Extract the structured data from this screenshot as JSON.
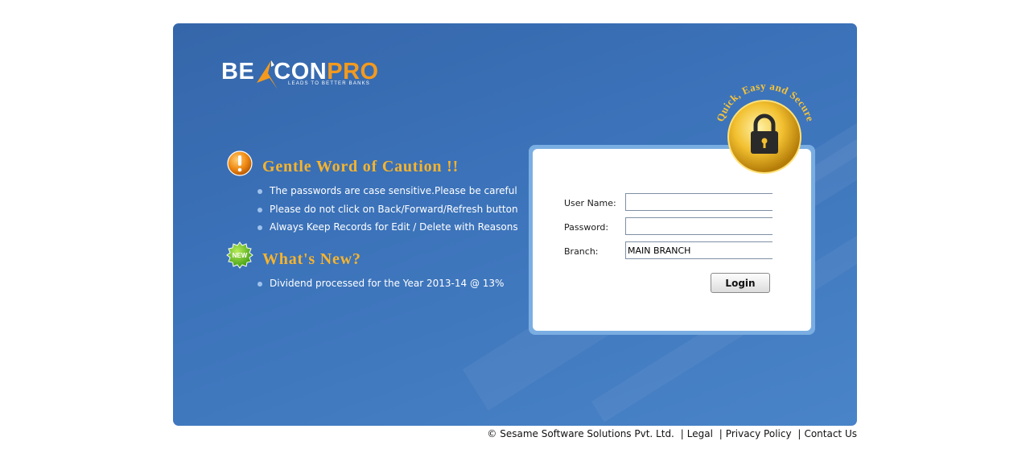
{
  "logo": {
    "part1": "BE",
    "part2": "CON",
    "part3": "PRO",
    "tagline": "LEADS TO BETTER BANKS",
    "brand_orange": "#f39a1e"
  },
  "seal": {
    "text": "Quick, Easy and Secure",
    "icon": "padlock-icon"
  },
  "caution": {
    "icon": "exclamation-icon",
    "title": "Gentle Word of Caution !!",
    "items": [
      "The passwords are case sensitive.Please be careful",
      "Please do not click on Back/Forward/Refresh button",
      "Always Keep Records for Edit / Delete with Reasons"
    ]
  },
  "whats_new": {
    "icon": "new-badge-icon",
    "badge_text": "NEW",
    "title": "What's New?",
    "items": [
      "Dividend processed for the Year 2013-14 @ 13%"
    ]
  },
  "login": {
    "username_label": "User Name:",
    "username_value": "",
    "password_label": "Password:",
    "password_value": "",
    "branch_label": "Branch:",
    "branch_value": "MAIN BRANCH",
    "button_label": "Login"
  },
  "footer": {
    "copyright": "© Sesame Software Solutions Pvt. Ltd.",
    "links": [
      "Legal",
      "Privacy Policy",
      "Contact Us"
    ]
  },
  "colors": {
    "panel_blue": "#3b72b9",
    "title_gold": "#f7b42c",
    "login_frame": "#7aaee2"
  }
}
